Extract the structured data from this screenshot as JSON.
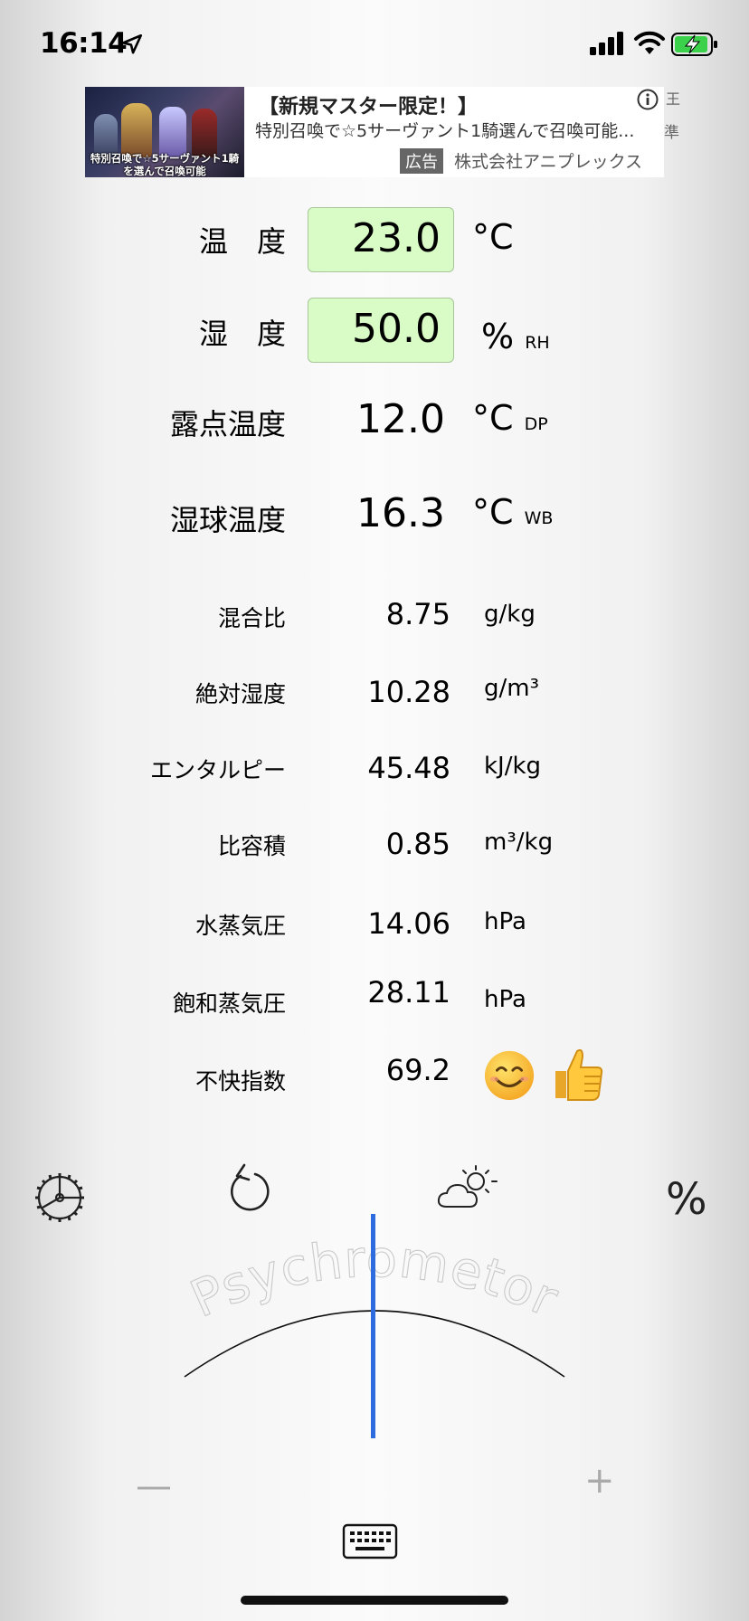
{
  "status_bar": {
    "time": "16:14"
  },
  "ad": {
    "title": "【新規マスター限定！】",
    "description": "特別召喚で☆5サーヴァント1騎選んで召喚可能...",
    "tag": "広告",
    "company": "株式会社アニプレックス",
    "image_caption": "特別召喚で☆5サーヴァント1騎を選んで召喚可能",
    "side_text_1": "王",
    "side_text_2": "準"
  },
  "inputs": {
    "temperature": {
      "label": "温　度",
      "value": "23.0",
      "unit": "°C"
    },
    "humidity": {
      "label": "湿　度",
      "value": "50.0",
      "unit": "%",
      "unit_sub": "RH"
    }
  },
  "results": {
    "dew_point": {
      "label": "露点温度",
      "value": "12.0",
      "unit": "°C",
      "unit_sub": "DP"
    },
    "wet_bulb": {
      "label": "湿球温度",
      "value": "16.3",
      "unit": "°C",
      "unit_sub": "WB"
    },
    "mixing_ratio": {
      "label": "混合比",
      "value": "8.75",
      "unit": "g/kg"
    },
    "absolute_humidity": {
      "label": "絶対湿度",
      "value": "10.28",
      "unit": "g/m³"
    },
    "enthalpy": {
      "label": "エンタルピー",
      "value": "45.48",
      "unit": "kJ/kg"
    },
    "specific_volume": {
      "label": "比容積",
      "value": "0.85",
      "unit": "m³/kg"
    },
    "vapor_pressure": {
      "label": "水蒸気圧",
      "value": "14.06",
      "unit": "hPa"
    },
    "saturation_vapor_pressure": {
      "label": "飽和蒸気圧",
      "value": "28.11",
      "unit": "hPa"
    },
    "discomfort_index": {
      "label": "不快指数",
      "value": "69.2"
    }
  },
  "toolbar": {
    "percent_label": "%"
  },
  "gauge": {
    "arc_text": "Psychrometor",
    "needle_color": "#2e6bdf"
  },
  "controls": {
    "minus": "—",
    "plus": "+"
  },
  "icons": [
    "location-arrow-icon",
    "signal-icon",
    "wifi-icon",
    "battery-charging-icon",
    "info-icon",
    "gear-icon",
    "undo-icon",
    "weather-icon",
    "keyboard-icon"
  ],
  "colors": {
    "input_bg": "#d9fbc6",
    "needle": "#2e6bdf"
  }
}
